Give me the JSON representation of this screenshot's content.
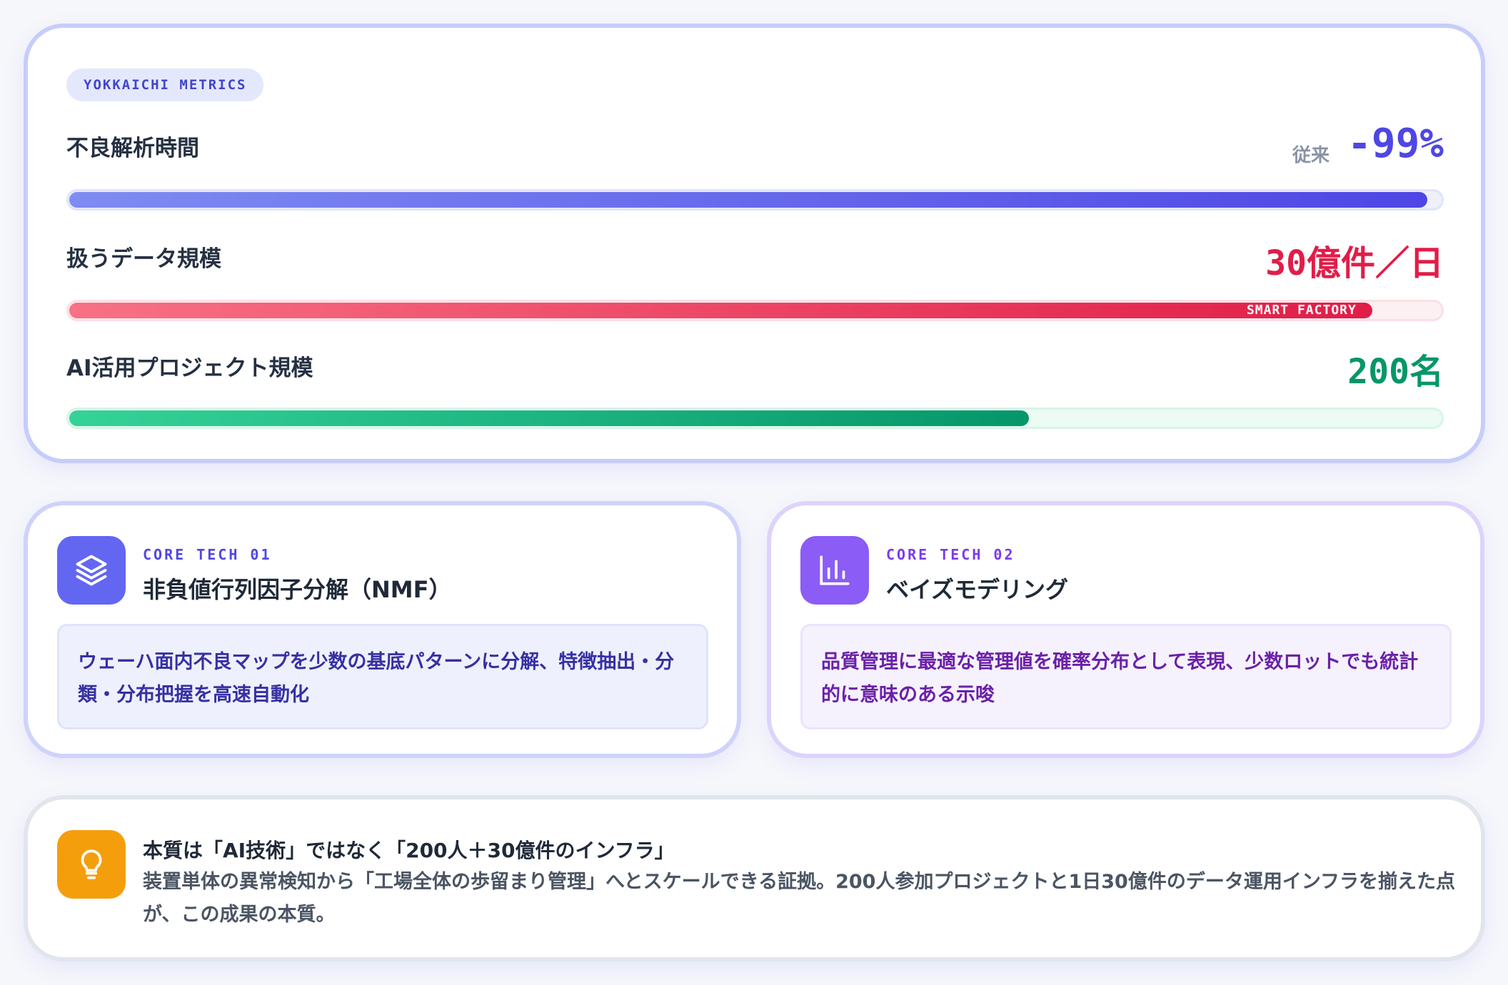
{
  "metrics_card": {
    "chip": "YOKKAICHI METRICS",
    "rows": [
      {
        "label": "不良解析時間",
        "prefix": "従来",
        "value": "-99%",
        "progress": 0.99,
        "color": "#4f46e5"
      },
      {
        "label": "扱うデータ規模",
        "value": "30億件／日",
        "progress": 0.95,
        "bar_tag": "SMART FACTORY",
        "color": "#e11d48"
      },
      {
        "label": "AI活用プロジェクト規模",
        "value": "200名",
        "progress": 0.7,
        "color": "#059669"
      }
    ]
  },
  "tech_cards": [
    {
      "code": "CORE TECH 01",
      "title": "非負値行列因子分解（NMF）",
      "description": "ウェーハ面内不良マップを少数の基底パターンに分解、特徴抽出・分類・分布把握を高速自動化",
      "icon": "layers-icon",
      "accent": "#6366f1"
    },
    {
      "code": "CORE TECH 02",
      "title": "ベイズモデリング",
      "description": "品質管理に最適な管理値を確率分布として表現、少数ロットでも統計的に意味のある示唆",
      "icon": "bar-chart-icon",
      "accent": "#8b5cf6"
    }
  ],
  "insight": {
    "title": "本質は「AI技術」ではなく「200人＋30億件のインフラ」",
    "body": "装置単体の異常検知から「工場全体の歩留まり管理」へとスケールできる証拠。200人参加プロジェクトと1日30億件のデータ運用インフラを揃えた点が、この成果の本質。",
    "icon": "lightbulb-icon",
    "accent": "#f59e0b"
  }
}
